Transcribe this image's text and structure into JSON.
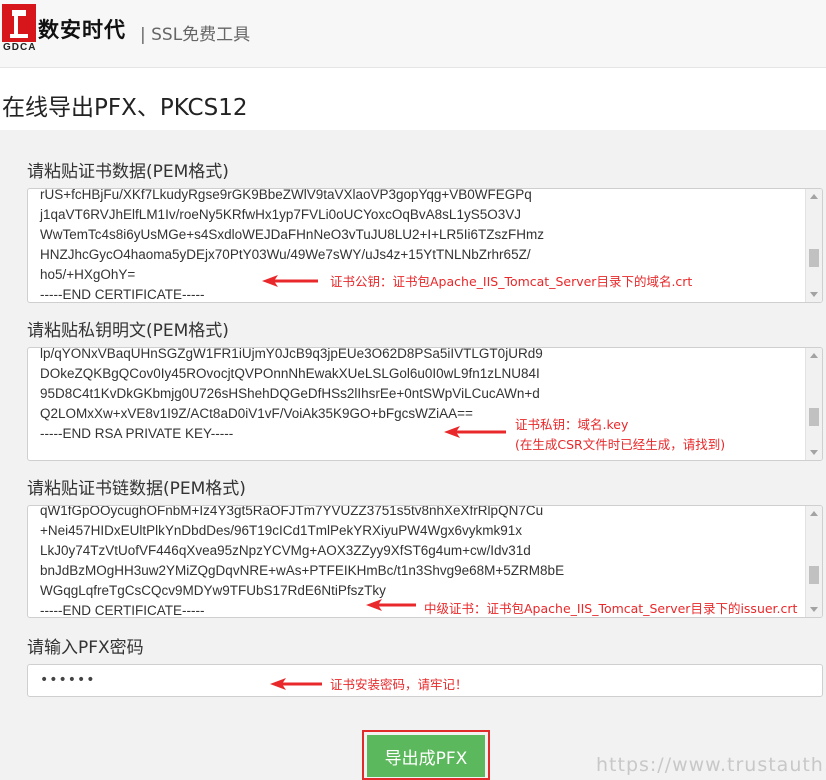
{
  "header": {
    "logo_text": "数安时代",
    "logo_sub": "GDCA",
    "tool_label": "| SSL免费工具"
  },
  "page": {
    "title": "在线导出PFX、PKCS12"
  },
  "cert": {
    "label": "请粘贴证书数据(PEM格式)",
    "lines": [
      "rUS+fcHBjFu/XKf7LkudyRgse9rGK9BbeZWlV9taVXlaoVP3gopYqg+VB0WFEGPq",
      "j1qaVT6RVJhElfLM1Iv/roeNy5KRfwHx1yp7FVLi0oUCYoxcOqBvA8sL1yS5O3VJ",
      "WwTemTc4s8i6yUsMGe+s4SxdloWEJDaFHnNeO3vTuJU8LU2+I+LR5Ii6TZszFHmz",
      "HNZJhcGycO4haoma5yDEjx70PtY03Wu/49We7sWY/uJs4z+15YtTNLNbZrhr65Z/",
      "ho5/+HXgOhY=",
      "-----END CERTIFICATE-----"
    ],
    "annotation": "证书公钥：证书包Apache_IIS_Tomcat_Server目录下的域名.crt"
  },
  "key": {
    "label": "请粘贴私钥明文(PEM格式)",
    "lines": [
      "lp/qYONxVBaqUHnSGZgW1FR1iUjmY0JcB9q3jpEUe3O62D8PSa5iIVTLGT0jURd9",
      "DOkeZQKBgQCov0Iy45ROvocjtQVPOnnNhEwakXUeLSLGol6u0I0wL9fn1zLNU84I",
      "95D8C4t1KvDkGKbmjg0U726sHShehDQGeDfHSs2lIhsrEe+0ntSWpViLCucAWn+d",
      "Q2LOMxXw+xVE8v1I9Z/ACt8aD0iV1vF/VoiAk35K9GO+bFgcsWZiAA==",
      "-----END RSA PRIVATE KEY-----"
    ],
    "annotation_line1": "证书私钥：域名.key",
    "annotation_line2": "(在生成CSR文件时已经生成，请找到)"
  },
  "chain": {
    "label": "请粘贴证书链数据(PEM格式)",
    "lines": [
      "qW1fGpOOycughOFnbM+Iz4Y3gt5RaOFJTm7YVUZZ3751s5tv8nhXeXfrRlpQN7Cu",
      "+Nei457HIDxEUltPlkYnDbdDes/96T19cICd1TmlPekYRXiyuPW4Wgx6vykmk91x",
      "LkJ0y74TzVtUofVF446qXvea95zNpzYCVMg+AOX3ZZyy9XfST6g4um+cw/Idv31d",
      "bnJdBzMOgHH3uw2YMiZQgDqvNRE+wAs+PTFEIKHmBc/t1n3Shvg9e68M+5ZRM8bE",
      "WGqgLqfreTgCsCQcv9MDYw9TFUbS17RdE6NtiPfszTky",
      "-----END CERTIFICATE-----"
    ],
    "annotation": "中级证书：证书包Apache_IIS_Tomcat_Server目录下的issuer.crt"
  },
  "password": {
    "label": "请输入PFX密码",
    "value": "••••••",
    "annotation": "证书安装密码，请牢记！"
  },
  "export_button": {
    "label": "导出成PFX"
  },
  "watermark": "https://www.trustauth.cn",
  "colors": {
    "button": "#5cb85c",
    "annotation": "#e8282a",
    "panel": "#f2f2f2"
  }
}
